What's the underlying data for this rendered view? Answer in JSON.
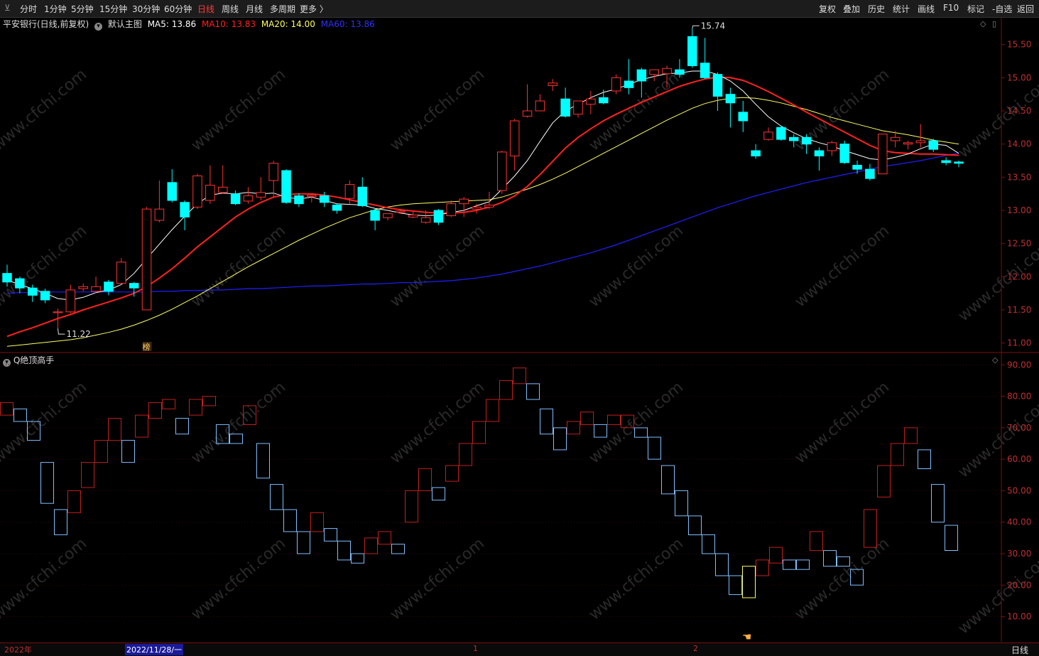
{
  "toolbar": {
    "left": [
      "分时",
      "1分钟",
      "5分钟",
      "15分钟",
      "30分钟",
      "60分钟",
      "日线",
      "周线",
      "月线",
      "多周期",
      "更多 〉"
    ],
    "active_index": 6,
    "right": [
      "复权",
      "叠加",
      "历史",
      "统计",
      "画线",
      "F10",
      "标记",
      "-自选",
      "返回"
    ]
  },
  "info": {
    "stock": "平安银行(日线,前复权)",
    "main_chart": "默认主图",
    "ma5": "MA5: 13.86",
    "ma10": "MA10: 13.83",
    "ma20": "MA20: 14.00",
    "ma60": "MA60: 13.86"
  },
  "indicator_title": "Q绝顶高手",
  "annotations": {
    "high": "15.74",
    "low": "11.22",
    "badge": "榜"
  },
  "bottom": {
    "year": "2022年",
    "date": "2022/11/28/一",
    "m1": "1",
    "m2": "2",
    "period": "日线"
  },
  "watermark": "www.cfchi.com",
  "colors": {
    "up": "#ff3232",
    "down": "#00ffff",
    "ma5": "#ffffff",
    "ma10": "#ff2020",
    "ma20": "#ffff60",
    "ma60": "#2020ff",
    "ind_up": "#c02020",
    "ind_down": "#7fbfff",
    "ind_special": "#ffff60"
  },
  "chart_data": [
    {
      "type": "candlestick",
      "ylim": [
        10.9,
        15.7
      ],
      "yticks": [
        "15.50",
        "15.00",
        "14.50",
        "14.00",
        "13.50",
        "13.00",
        "12.50",
        "12.00",
        "11.50",
        "11.00"
      ],
      "candles": [
        [
          12.05,
          11.92,
          12.18,
          11.85
        ],
        [
          11.97,
          11.83,
          12.0,
          11.75
        ],
        [
          11.83,
          11.72,
          11.88,
          11.62
        ],
        [
          11.78,
          11.65,
          11.82,
          11.6
        ],
        [
          11.47,
          11.47,
          11.52,
          11.22
        ],
        [
          11.47,
          11.8,
          11.88,
          11.45
        ],
        [
          11.82,
          11.85,
          11.9,
          11.78
        ],
        [
          11.78,
          11.85,
          12.0,
          11.75
        ],
        [
          11.92,
          11.78,
          11.95,
          11.72
        ],
        [
          11.9,
          12.22,
          12.28,
          11.88
        ],
        [
          11.9,
          11.83,
          11.92,
          11.7
        ],
        [
          11.5,
          13.02,
          13.05,
          11.5
        ],
        [
          12.85,
          13.02,
          13.45,
          12.82
        ],
        [
          13.42,
          13.15,
          13.62,
          13.12
        ],
        [
          13.12,
          12.9,
          13.15,
          12.7
        ],
        [
          13.05,
          13.52,
          13.55,
          13.02
        ],
        [
          13.15,
          13.38,
          13.68,
          13.1
        ],
        [
          13.27,
          13.35,
          13.68,
          13.25
        ],
        [
          13.25,
          13.1,
          13.3,
          13.08
        ],
        [
          13.14,
          13.22,
          13.35,
          13.1
        ],
        [
          13.2,
          13.27,
          13.5,
          13.15
        ],
        [
          13.45,
          13.71,
          13.75,
          13.2
        ],
        [
          13.6,
          13.12,
          13.62,
          13.1
        ],
        [
          13.22,
          13.1,
          13.26,
          13.05
        ],
        [
          13.21,
          13.23,
          13.25,
          13.12
        ],
        [
          13.22,
          13.12,
          13.28,
          13.05
        ],
        [
          13.08,
          13.0,
          13.1,
          12.95
        ],
        [
          13.18,
          13.39,
          13.45,
          13.1
        ],
        [
          13.35,
          13.07,
          13.5,
          13.05
        ],
        [
          13.0,
          12.85,
          13.03,
          12.7
        ],
        [
          12.89,
          12.95,
          12.95,
          12.85
        ],
        [
          12.97,
          12.99,
          13.02,
          12.95
        ],
        [
          12.9,
          12.93,
          12.98,
          12.88
        ],
        [
          12.82,
          12.89,
          13.0,
          12.8
        ],
        [
          13.0,
          12.82,
          13.02,
          12.78
        ],
        [
          12.92,
          13.1,
          13.15,
          12.9
        ],
        [
          13.1,
          13.17,
          13.2,
          12.9
        ],
        [
          13.02,
          13.05,
          13.1,
          12.95
        ],
        [
          13.05,
          13.08,
          13.28,
          13.02
        ],
        [
          13.3,
          13.88,
          13.9,
          13.25
        ],
        [
          13.82,
          14.35,
          14.38,
          13.6
        ],
        [
          14.42,
          14.5,
          14.9,
          14.4
        ],
        [
          14.5,
          14.65,
          14.75,
          14.5
        ],
        [
          14.88,
          14.92,
          14.98,
          14.8
        ],
        [
          14.68,
          14.42,
          14.85,
          14.4
        ],
        [
          14.45,
          14.65,
          14.65,
          14.4
        ],
        [
          14.6,
          14.68,
          14.8,
          14.45
        ],
        [
          14.7,
          14.62,
          14.82,
          14.6
        ],
        [
          14.8,
          15.0,
          15.05,
          14.75
        ],
        [
          14.95,
          14.85,
          15.28,
          14.75
        ],
        [
          15.12,
          14.95,
          15.15,
          14.7
        ],
        [
          15.05,
          15.12,
          15.12,
          14.95
        ],
        [
          15.06,
          15.14,
          15.18,
          14.85
        ],
        [
          15.12,
          15.05,
          15.28,
          15.0
        ],
        [
          15.62,
          15.18,
          15.74,
          15.15
        ],
        [
          15.22,
          15.0,
          15.6,
          14.98
        ],
        [
          15.05,
          14.72,
          15.08,
          14.5
        ],
        [
          14.75,
          14.62,
          14.85,
          14.25
        ],
        [
          14.48,
          14.35,
          14.65,
          14.18
        ],
        [
          13.9,
          13.82,
          14.0,
          13.78
        ],
        [
          14.07,
          14.18,
          14.25,
          14.05
        ],
        [
          14.25,
          14.07,
          14.28,
          14.05
        ],
        [
          14.1,
          14.05,
          14.15,
          13.95
        ],
        [
          14.1,
          14.0,
          14.15,
          13.85
        ],
        [
          13.9,
          13.82,
          13.95,
          13.6
        ],
        [
          13.9,
          14.02,
          14.05,
          13.82
        ],
        [
          14.0,
          13.72,
          14.05,
          13.7
        ],
        [
          13.68,
          13.62,
          13.75,
          13.55
        ],
        [
          13.62,
          13.48,
          13.7,
          13.45
        ],
        [
          13.55,
          14.15,
          14.15,
          13.55
        ],
        [
          14.05,
          14.1,
          14.2,
          13.95
        ],
        [
          14.0,
          14.02,
          14.05,
          13.92
        ],
        [
          14.02,
          14.05,
          14.3,
          13.95
        ],
        [
          14.05,
          13.92,
          14.08,
          13.88
        ],
        [
          13.75,
          13.72,
          13.8,
          13.68
        ],
        [
          13.73,
          13.71,
          13.75,
          13.65
        ]
      ],
      "ma5": [
        11.95,
        11.88,
        11.82,
        11.75,
        11.67,
        11.65,
        11.69,
        11.76,
        11.8,
        11.88,
        12.05,
        12.27,
        12.49,
        12.71,
        12.91,
        13.1,
        13.23,
        13.26,
        13.25,
        13.27,
        13.25,
        13.26,
        13.2,
        13.17,
        13.2,
        13.15,
        13.1,
        13.09,
        13.08,
        13.03,
        13.0,
        12.96,
        12.93,
        12.92,
        12.93,
        12.97,
        13.0,
        13.07,
        13.13,
        13.32,
        13.52,
        13.75,
        14.04,
        14.32,
        14.5,
        14.6,
        14.7,
        14.78,
        14.83,
        14.9,
        14.97,
        15.02,
        15.06,
        15.07,
        15.1,
        15.1,
        15.05,
        14.95,
        14.8,
        14.6,
        14.41,
        14.27,
        14.17,
        14.08,
        14.02,
        13.97,
        13.9,
        13.84,
        13.78,
        13.76,
        13.8,
        13.85,
        13.93,
        14.0,
        13.98,
        13.86
      ],
      "ma10": [
        11.1,
        11.17,
        11.23,
        11.3,
        11.37,
        11.43,
        11.5,
        11.56,
        11.62,
        11.68,
        11.75,
        11.85,
        11.98,
        12.12,
        12.28,
        12.45,
        12.6,
        12.75,
        12.9,
        13.02,
        13.12,
        13.2,
        13.24,
        13.25,
        13.25,
        13.23,
        13.2,
        13.16,
        13.12,
        13.08,
        13.04,
        13.01,
        12.99,
        12.97,
        12.96,
        12.96,
        12.97,
        13.0,
        13.05,
        13.12,
        13.22,
        13.36,
        13.54,
        13.74,
        13.94,
        14.1,
        14.23,
        14.35,
        14.45,
        14.54,
        14.63,
        14.71,
        14.79,
        14.87,
        14.93,
        14.98,
        15.01,
        15.0,
        14.96,
        14.88,
        14.79,
        14.69,
        14.59,
        14.48,
        14.38,
        14.28,
        14.18,
        14.08,
        13.98,
        13.9,
        13.87,
        13.86,
        13.85,
        13.85,
        13.84,
        13.83
      ],
      "ma20": [
        10.95,
        10.97,
        10.99,
        11.01,
        11.03,
        11.05,
        11.08,
        11.12,
        11.16,
        11.21,
        11.27,
        11.34,
        11.42,
        11.51,
        11.61,
        11.71,
        11.82,
        11.93,
        12.04,
        12.15,
        12.25,
        12.35,
        12.45,
        12.55,
        12.64,
        12.73,
        12.81,
        12.89,
        12.95,
        13.01,
        13.05,
        13.08,
        13.1,
        13.11,
        13.12,
        13.13,
        13.14,
        13.15,
        13.16,
        13.2,
        13.26,
        13.32,
        13.39,
        13.47,
        13.56,
        13.66,
        13.76,
        13.86,
        13.96,
        14.06,
        14.16,
        14.26,
        14.36,
        14.45,
        14.54,
        14.61,
        14.66,
        14.69,
        14.7,
        14.69,
        14.66,
        14.62,
        14.57,
        14.52,
        14.46,
        14.4,
        14.35,
        14.3,
        14.25,
        14.2,
        14.17,
        14.14,
        14.1,
        14.06,
        14.03,
        14.0
      ],
      "ma60": [
        11.75,
        11.76,
        11.76,
        11.77,
        11.77,
        11.77,
        11.77,
        11.77,
        11.77,
        11.77,
        11.77,
        11.77,
        11.78,
        11.78,
        11.79,
        11.79,
        11.8,
        11.8,
        11.81,
        11.82,
        11.82,
        11.83,
        11.84,
        11.85,
        11.86,
        11.86,
        11.87,
        11.88,
        11.89,
        11.89,
        11.9,
        11.91,
        11.91,
        11.92,
        11.93,
        11.94,
        11.96,
        11.98,
        12.01,
        12.04,
        12.08,
        12.12,
        12.16,
        12.21,
        12.26,
        12.31,
        12.36,
        12.42,
        12.48,
        12.55,
        12.62,
        12.69,
        12.76,
        12.83,
        12.9,
        12.97,
        13.04,
        13.1,
        13.16,
        13.22,
        13.27,
        13.32,
        13.37,
        13.42,
        13.46,
        13.5,
        13.54,
        13.58,
        13.62,
        13.66,
        13.69,
        13.72,
        13.75,
        13.79,
        13.83,
        13.86
      ]
    },
    {
      "type": "box-indicator",
      "title": "Q绝顶高手",
      "ylim": [
        2,
        93
      ],
      "yticks": [
        "90.00",
        "80.00",
        "70.00",
        "60.00",
        "50.00",
        "40.00",
        "30.00",
        "20.00",
        "10.00"
      ],
      "boxes": [
        [
          78,
          74,
          "u"
        ],
        [
          76,
          72,
          "d"
        ],
        [
          72,
          66,
          "d"
        ],
        [
          59,
          46,
          "d"
        ],
        [
          44,
          36,
          "d"
        ],
        [
          50,
          43,
          "u"
        ],
        [
          59,
          51,
          "u"
        ],
        [
          66,
          59,
          "u"
        ],
        [
          73,
          66,
          "u"
        ],
        [
          59,
          66,
          "d"
        ],
        [
          74,
          67,
          "u"
        ],
        [
          78,
          73,
          "u"
        ],
        [
          79,
          76,
          "u"
        ],
        [
          73,
          68,
          "d"
        ],
        [
          79,
          74,
          "u"
        ],
        [
          80,
          77,
          "u"
        ],
        [
          71,
          65,
          "d"
        ],
        [
          68,
          65,
          "d"
        ],
        [
          77,
          71,
          "u"
        ],
        [
          65,
          54,
          "d"
        ],
        [
          52,
          44,
          "d"
        ],
        [
          44,
          37,
          "d"
        ],
        [
          37,
          30,
          "d"
        ],
        [
          43,
          37,
          "u"
        ],
        [
          38,
          34,
          "d"
        ],
        [
          34,
          28,
          "d"
        ],
        [
          30,
          27,
          "d"
        ],
        [
          35,
          30,
          "u"
        ],
        [
          37,
          33,
          "u"
        ],
        [
          33,
          30,
          "d"
        ],
        [
          40,
          50,
          "u"
        ],
        [
          57,
          50,
          "u"
        ],
        [
          51,
          47,
          "d"
        ],
        [
          58,
          53,
          "u"
        ],
        [
          65,
          58,
          "u"
        ],
        [
          72,
          65,
          "u"
        ],
        [
          79,
          72,
          "u"
        ],
        [
          85,
          79,
          "u"
        ],
        [
          89,
          84,
          "u"
        ],
        [
          84,
          79,
          "d"
        ],
        [
          76,
          68,
          "d"
        ],
        [
          70,
          63,
          "d"
        ],
        [
          68,
          72,
          "u"
        ],
        [
          75,
          71,
          "u"
        ],
        [
          71,
          67,
          "d"
        ],
        [
          74,
          71,
          "u"
        ],
        [
          74,
          70,
          "u"
        ],
        [
          70,
          67,
          "d"
        ],
        [
          67,
          60,
          "d"
        ],
        [
          58,
          49,
          "d"
        ],
        [
          50,
          42,
          "d"
        ],
        [
          42,
          36,
          "d"
        ],
        [
          36,
          30,
          "d"
        ],
        [
          30,
          23,
          "d"
        ],
        [
          23,
          17,
          "d"
        ],
        [
          26,
          16,
          "s"
        ],
        [
          28,
          23,
          "u"
        ],
        [
          32,
          27,
          "u"
        ],
        [
          28,
          25,
          "d"
        ],
        [
          28,
          25,
          "d"
        ],
        [
          37,
          31,
          "u"
        ],
        [
          31,
          26,
          "d"
        ],
        [
          29,
          26,
          "d"
        ],
        [
          25,
          20,
          "d"
        ],
        [
          44,
          32,
          "u"
        ],
        [
          58,
          48,
          "u"
        ],
        [
          65,
          58,
          "u"
        ],
        [
          70,
          65,
          "u"
        ],
        [
          63,
          57,
          "d"
        ],
        [
          52,
          40,
          "d"
        ],
        [
          39,
          31,
          "d"
        ]
      ]
    }
  ]
}
